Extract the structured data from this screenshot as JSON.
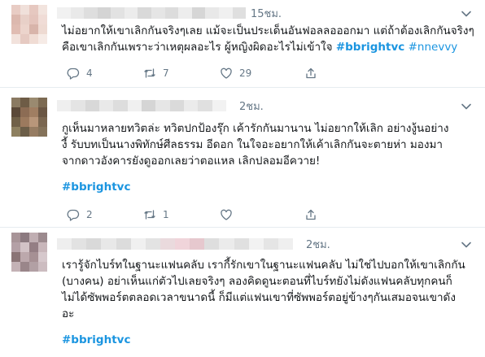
{
  "tweets": [
    {
      "time": "15ชม.",
      "lines": [
        "ไม่อยากให้เขาเลิกกันจริงๆเลย แม้จะเป็นประเด็นอันฟอลลอออกมา แต่ถ้าต้องเลิกกันจริงๆ",
        "คือเขาเลิกกันเพราะว่าเหตุผลอะไร ผู้หญิงผิดอะไรไม่เข้าใจ "
      ],
      "hashtags": [
        "#bbrightvc",
        "#nnevvy"
      ],
      "actions": {
        "replies": "4",
        "retweets": "7",
        "likes": "29"
      }
    },
    {
      "time": "2ชม.",
      "lines": [
        "กูเห็นมาหลายทวิตล่ะ ทวิตปกป้องรุ๊ก เค้ารักกันมานาน ไม่อยากให้เลิก อย่างงู้นอย่าง",
        "งี้ รับบทเป็นนางพิทักษ์ศีลธรรม อีดอก ในใจอะอยากให้เค้าเลิกกันจะตายห่า มองมา",
        "จากดาวอังคารยังดูออกเลยว่าตอแหล เลิกปลอมอีควาย!"
      ],
      "hashtag": "#bbrightvc",
      "actions": {
        "replies": "2",
        "retweets": "1",
        "likes": ""
      }
    },
    {
      "time": "2ชม.",
      "lines": [
        "เรารู้จักไบร์ทในฐานะแฟนคลับ เรากี้รักเขาในฐานะแฟนคลับ ไม่ใช่ไปบอกให้เขาเลิกกัน",
        "(บางคน) อย่าเห็นแก่ตัวไปเลยจริงๆ ลองคิดดูนะตอนที่ไบร์ทยังไม่ดังแฟนคลับทุกคนก็",
        "ไม่ได้ซัพพอร์ตตลอดเวลาขนาดนี้ ก็มีแต่แฟนเขาที่ซัพพอร์ตอยู่ข้างๆกันเสมอจนเขาดัง",
        "อะ"
      ],
      "hashtag": "#bbrightvc"
    }
  ],
  "colors": {
    "accent": "#1b95e0",
    "muted": "#657786",
    "text": "#14171a",
    "divider": "#e6ecf0"
  },
  "icons": [
    "reply-icon",
    "retweet-icon",
    "like-icon",
    "share-icon",
    "chevron-down-icon"
  ]
}
